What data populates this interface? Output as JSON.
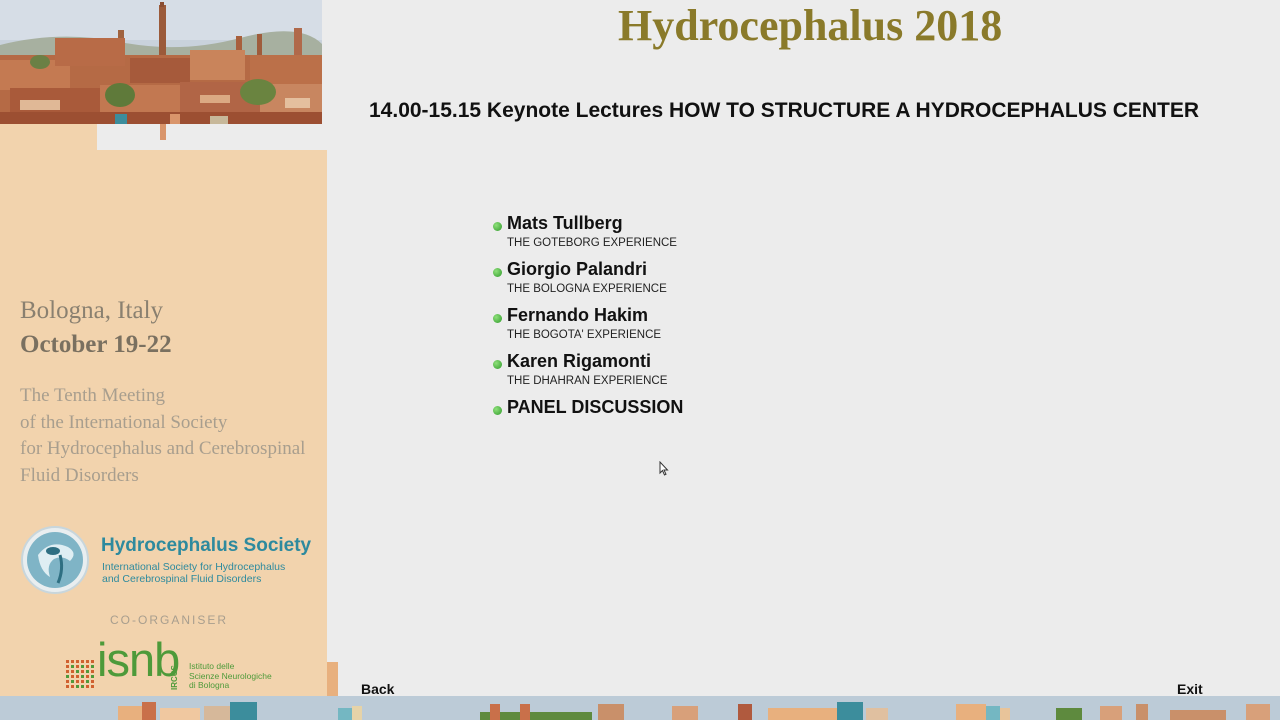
{
  "header": {
    "title": "Hydrocephalus 2018",
    "session": "14.00-15.15 Keynote Lectures HOW TO STRUCTURE A HYDROCEPHALUS CENTER"
  },
  "speakers": [
    {
      "name": "Mats Tullberg",
      "topic": "THE GOTEBORG EXPERIENCE"
    },
    {
      "name": "Giorgio Palandri",
      "topic": "THE BOLOGNA EXPERIENCE"
    },
    {
      "name": "Fernando Hakim",
      "topic": "THE BOGOTA' EXPERIENCE"
    },
    {
      "name": "Karen Rigamonti",
      "topic": "THE DHAHRAN EXPERIENCE"
    },
    {
      "name": "PANEL DISCUSSION",
      "topic": ""
    }
  ],
  "sidebar": {
    "city": "Bologna, Italy",
    "dates": "October 19-22",
    "meeting_lines": [
      "The Tenth Meeting",
      "of the International Society",
      "for Hydrocephalus and Cerebrospinal",
      "Fluid Disorders"
    ],
    "society_name": "Hydrocephalus Society",
    "society_sub_lines": [
      "International Society for Hydrocephalus",
      "and Cerebrospinal Fluid Disorders"
    ],
    "coorganiser": "CO-ORGANISER",
    "isnb": "isnb",
    "irccs": "IRCCS",
    "isnb_desc_lines": [
      "Istituto delle",
      "Scienze Neurologiche",
      "di Bologna"
    ]
  },
  "nav": {
    "back": "Back",
    "exit": "Exit"
  },
  "colors": {
    "title": "#8a7a2a",
    "sidebar_bg": "#f2d3ad",
    "bullet": "#2f9a2a",
    "society": "#2e8a9e",
    "isnb": "#4e9a3a"
  }
}
